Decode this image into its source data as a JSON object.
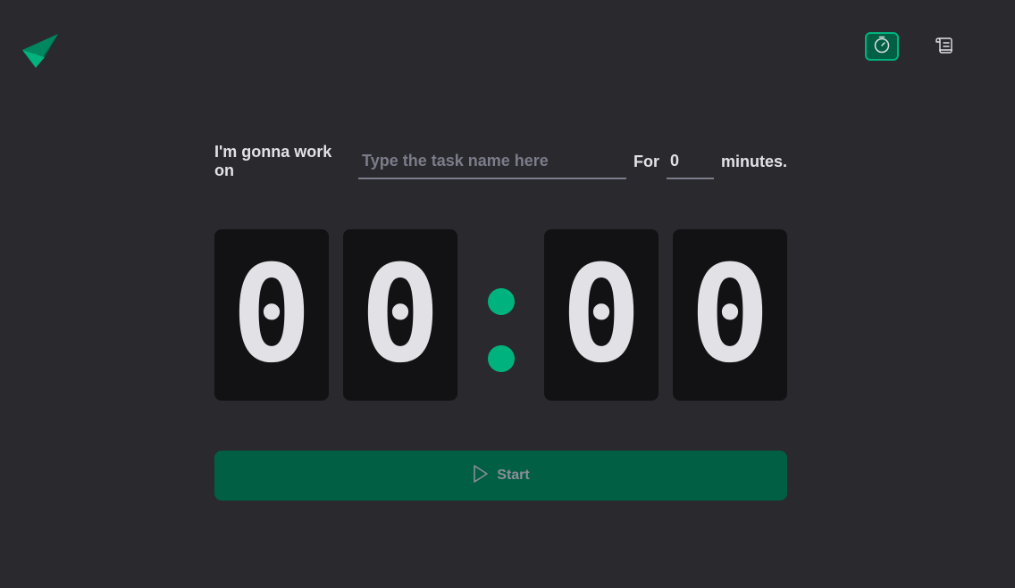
{
  "nav": {
    "timer_icon": "timer-icon",
    "history_icon": "scroll-icon"
  },
  "form": {
    "prefix_label": "I'm gonna work on",
    "task_placeholder": "Type the task name here",
    "task_value": "",
    "for_label": "For",
    "minutes_value": "0",
    "suffix_label": "minutes."
  },
  "countdown": {
    "minutes_tens": "0",
    "minutes_ones": "0",
    "seconds_tens": "0",
    "seconds_ones": "0"
  },
  "start_button": {
    "label": "Start",
    "icon": "play-icon",
    "disabled": true
  },
  "colors": {
    "background": "#29292e",
    "digit_bg": "#121214",
    "accent": "#00b37e",
    "accent_dark": "#015f43",
    "text": "#e1e1e6",
    "placeholder": "#7c7c8a"
  }
}
